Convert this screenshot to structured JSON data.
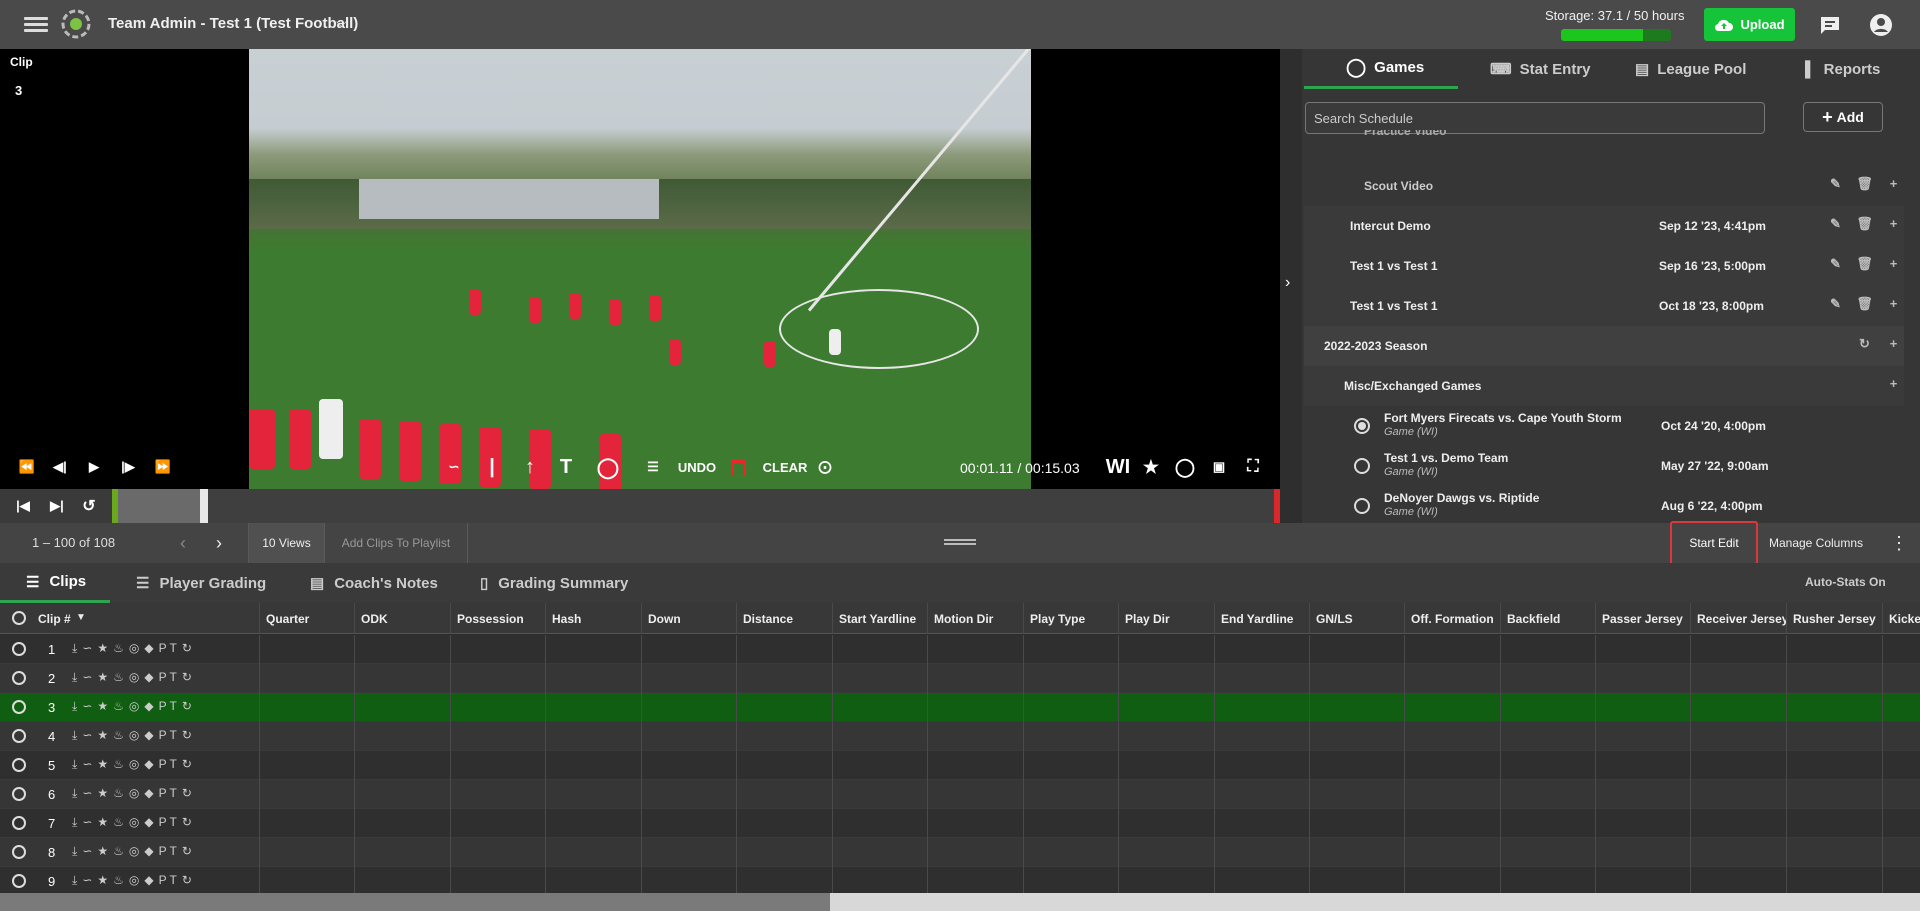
{
  "topbar": {
    "team_title": "Team Admin - Test 1 (Test Football)",
    "storage": "Storage: 37.1 / 50 hours",
    "storage_fraction": 0.742,
    "upload_label": "Upload"
  },
  "player": {
    "clip_label": "Clip",
    "clip_number": "3",
    "undo_label": "UNDO",
    "clear_label": "CLEAR",
    "time": "00:01.11 / 00:15.03",
    "wi_label": "WI"
  },
  "right_tabs": [
    {
      "label": "Games",
      "icon": "play-circle-icon"
    },
    {
      "label": "Stat Entry",
      "icon": "keyboard-icon"
    },
    {
      "label": "League Pool",
      "icon": "video-library-icon"
    },
    {
      "label": "Reports",
      "icon": "bar-chart-icon"
    }
  ],
  "search": {
    "placeholder": "Search Schedule"
  },
  "add_label": "Add",
  "schedule": {
    "practice_video": "Practice Video",
    "scout_video": "Scout Video",
    "games": [
      {
        "name": "Intercut Demo",
        "date": "Sep 12 '23, 4:41pm"
      },
      {
        "name": "Test 1 vs Test 1",
        "date": "Sep 16 '23, 5:00pm"
      },
      {
        "name": "Test 1 vs Test 1",
        "date": "Oct 18 '23, 8:00pm"
      }
    ],
    "season": "2022-2023 Season",
    "misc": "Misc/Exchanged Games",
    "exchanged": [
      {
        "name": "Fort Myers Firecats vs. Cape Youth Storm",
        "sub": "Game (WI)",
        "date": "Oct 24 '20, 4:00pm"
      },
      {
        "name": "Test 1 vs. Demo Team",
        "sub": "Game (WI)",
        "date": "May 27 '22, 9:00am"
      },
      {
        "name": "DeNoyer Dawgs vs. Riptide",
        "sub": "Game (WI)",
        "date": "Aug 6 '22, 4:00pm"
      }
    ]
  },
  "listbar": {
    "count": "1 – 100 of 108",
    "views": "10 Views",
    "add_clips": "Add Clips To Playlist",
    "start_edit": "Start Edit",
    "manage_columns": "Manage Columns"
  },
  "subtabs": [
    {
      "label": "Clips",
      "icon": "list-icon"
    },
    {
      "label": "Player Grading",
      "icon": "checklist-icon"
    },
    {
      "label": "Coach's Notes",
      "icon": "comment-icon"
    },
    {
      "label": "Grading Summary",
      "icon": "document-icon"
    }
  ],
  "autostats": "Auto-Stats On",
  "grid": {
    "columns": [
      "Clip #",
      "Quarter",
      "ODK",
      "Possession",
      "Hash",
      "Down",
      "Distance",
      "Start Yardline",
      "Motion Dir",
      "Play Type",
      "Play Dir",
      "End Yardline",
      "GN/LS",
      "Off. Formation",
      "Backfield",
      "Passer Jersey",
      "Receiver Jersey",
      "Rusher Jersey",
      "Kicker"
    ],
    "rows": [
      "1",
      "2",
      "3",
      "4",
      "5",
      "6",
      "7",
      "8",
      "9"
    ],
    "row_icons": "P T",
    "selected_row": "3"
  },
  "colors": {
    "accent": "#2ea44f",
    "upload": "#16c43a",
    "selected_row": "#0f5e12",
    "highlight_border": "#d9383c"
  }
}
